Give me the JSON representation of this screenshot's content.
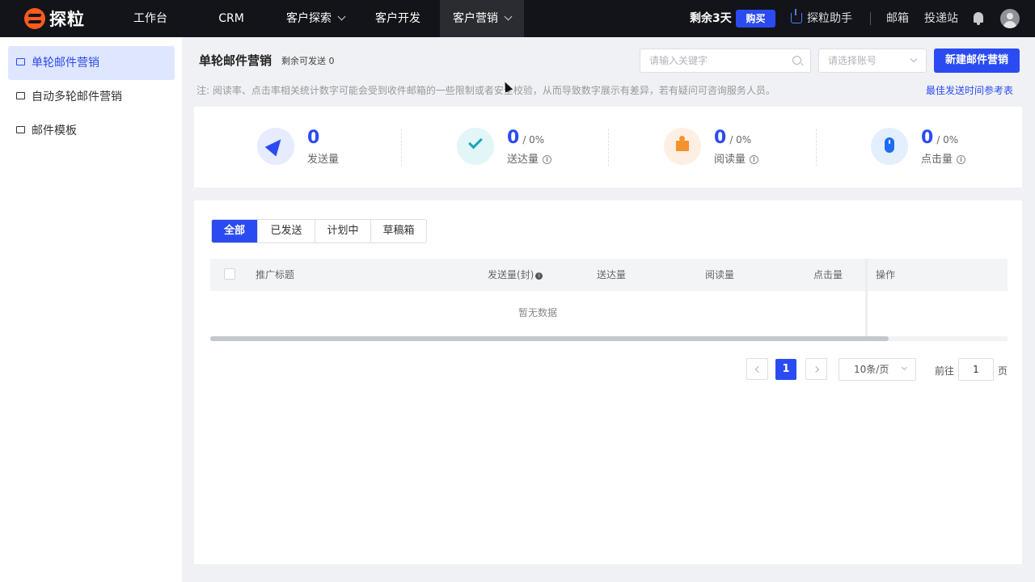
{
  "app": {
    "logo_text": "探粒",
    "nav": [
      {
        "label": "工作台"
      },
      {
        "label": "CRM"
      },
      {
        "label": "客户探索"
      },
      {
        "label": "客户开发"
      },
      {
        "label": "客户营销"
      }
    ],
    "remain_days": "剩余3天",
    "buy_label": "购买",
    "assistant_label": "探粒助手",
    "mail_label": "邮箱",
    "deliver_label": "投递站"
  },
  "sidebar": {
    "items": [
      {
        "label": "单轮邮件营销"
      },
      {
        "label": "自动多轮邮件营销"
      },
      {
        "label": "邮件模板"
      }
    ]
  },
  "page": {
    "title": "单轮邮件营销",
    "remain_send": "剩余可发送 0",
    "search_placeholder": "请输入关键字",
    "account_placeholder": "请选择账号",
    "new_button": "新建邮件营销",
    "note": "注: 阅读率、点击率相关统计数字可能会受到收件邮箱的一些限制或者安全校验，从而导致数字展示有差异，若有疑问可咨询服务人员。",
    "best_time_link": "最佳发送时间参考表"
  },
  "stats": [
    {
      "value": "0",
      "percent": "",
      "label": "发送量",
      "color": "#2b4bf2",
      "bg": "#e6ebfd"
    },
    {
      "value": "0",
      "percent": "/ 0%",
      "label": "送达量",
      "color": "#16a6b6",
      "bg": "#e2f6f8"
    },
    {
      "value": "0",
      "percent": "/ 0%",
      "label": "阅读量",
      "color": "#f5922f",
      "bg": "#fdf0e2"
    },
    {
      "value": "0",
      "percent": "/ 0%",
      "label": "点击量",
      "color": "#1e6cf2",
      "bg": "#e3effd"
    }
  ],
  "tabs": [
    {
      "label": "全部"
    },
    {
      "label": "已发送"
    },
    {
      "label": "计划中"
    },
    {
      "label": "草稿箱"
    }
  ],
  "table": {
    "columns": [
      "推广标题",
      "发送量(封)",
      "送达量",
      "阅读量",
      "点击量",
      "操作"
    ],
    "empty_text": "暂无数据"
  },
  "pagination": {
    "current_page": "1",
    "page_size": "10条/页",
    "goto_label": "前往",
    "goto_value": "1",
    "page_unit": "页"
  }
}
